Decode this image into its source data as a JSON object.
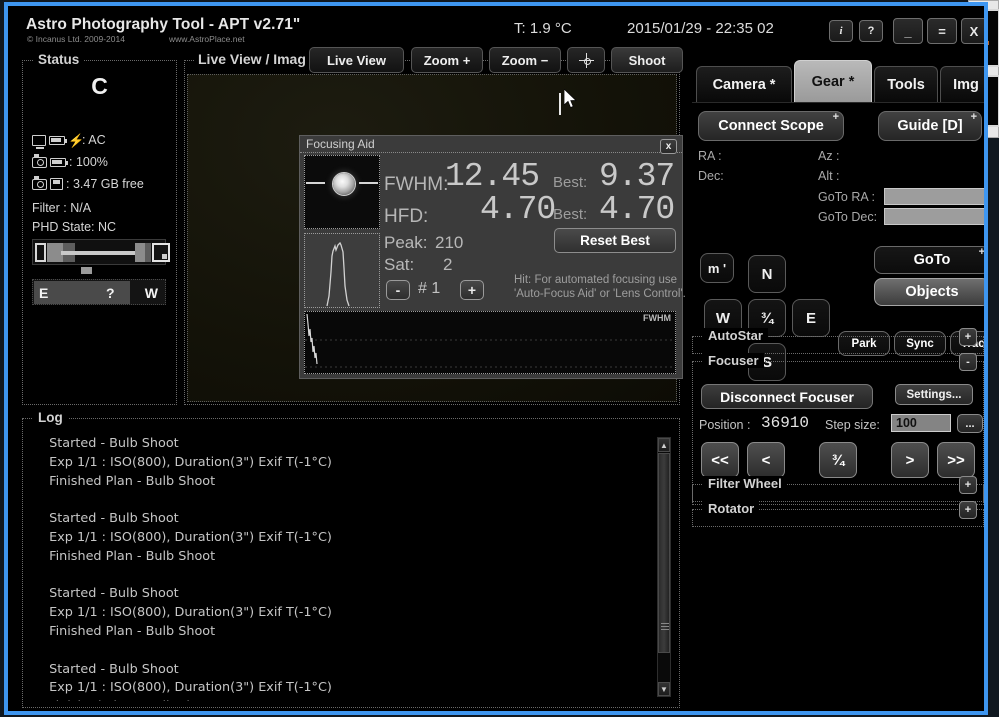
{
  "window": {
    "app_title": "Astro Photography Tool - APT v2.71\"",
    "copyright": "© Incanus Ltd. 2009-2014",
    "url": "www.AstroPlace.net",
    "temperature": "T: 1.9 °C",
    "datetime": "2015/01/29 - 22:35 02",
    "buttons": {
      "info": "i",
      "help": "?",
      "minimize": "_",
      "restore": "=",
      "close": "X"
    }
  },
  "status": {
    "title": "Status",
    "letter": "C",
    "power": ": AC",
    "battery": ": 100%",
    "disk": ": 3.47 GB free",
    "filter": "Filter : N/A",
    "phd_state": "PHD State: NC",
    "compass": {
      "east": "E",
      "unknown": "?",
      "west": "W"
    }
  },
  "liveview": {
    "title": "Live View / Imag",
    "buttons": {
      "live_view": "Live View",
      "zoom_in": "Zoom +",
      "zoom_out": "Zoom −",
      "shoot": "Shoot"
    }
  },
  "focusing_aid": {
    "title": "Focusing Aid",
    "close": "x",
    "fwhm_label": "FWHM:",
    "fwhm_value": "12.45",
    "fwhm_best_label": "Best:",
    "fwhm_best_value": "9.37",
    "hfd_label": "HFD:",
    "hfd_value": "4.70",
    "hfd_best_label": "Best:",
    "hfd_best_value": "4.70",
    "peak_label": "Peak:",
    "peak_value": "210",
    "sat_label": "Sat:",
    "sat_value": "2",
    "reset_best": "Reset Best",
    "minus": "-",
    "plus": "+",
    "counter": "# 1",
    "hint_line1": "Hit: For automated focusing use",
    "hint_line2": "'Auto-Focus Aid' or 'Lens Control'.",
    "chart_label": "FWHM"
  },
  "log": {
    "title": "Log",
    "text": "  Started - Bulb Shoot\n  Exp 1/1 : ISO(800), Duration(3\") Exif T(-1°C)\n  Finished Plan - Bulb Shoot\n\n  Started - Bulb Shoot\n  Exp 1/1 : ISO(800), Duration(3\") Exif T(-1°C)\n  Finished Plan - Bulb Shoot\n\n  Started - Bulb Shoot\n  Exp 1/1 : ISO(800), Duration(3\") Exif T(-1°C)\n  Finished Plan - Bulb Shoot\n\n  Started - Bulb Shoot\n  Exp 1/1 : ISO(800), Duration(3\") Exif T(-1°C)\n  Finished Plan - Bulb Shoot"
  },
  "right_panel": {
    "tabs": [
      {
        "label": "Camera *",
        "active": false
      },
      {
        "label": "Gear *",
        "active": true
      },
      {
        "label": "Tools",
        "active": false
      },
      {
        "label": "Img",
        "active": false
      }
    ],
    "connect_scope": "Connect Scope",
    "guide": "Guide [D]",
    "plus_badge": "+",
    "labels": {
      "ra": "RA :",
      "dec": "Dec:",
      "az": "Az :",
      "alt": "Alt :",
      "goto_ra": "GoTo RA :",
      "goto_dec": "GoTo Dec:"
    },
    "values": {
      "ra": "",
      "dec": "",
      "az": "",
      "alt": "",
      "goto_ra": "",
      "goto_dec": ""
    },
    "direction": {
      "rate": "m '",
      "north": "N",
      "west": "W",
      "stop": "¾",
      "east": "E",
      "south": "S"
    },
    "goto": "GoTo",
    "objects": "Objects",
    "park": "Park",
    "sync": "Sync",
    "track": "Track",
    "sections": {
      "autostar": {
        "title": "AutoStar",
        "toggle": "+"
      },
      "focuser": {
        "title": "Focuser",
        "toggle": "-"
      },
      "filter_wheel": {
        "title": "Filter Wheel",
        "toggle": "+"
      },
      "rotator": {
        "title": "Rotator",
        "toggle": "+"
      }
    },
    "focuser": {
      "disconnect": "Disconnect Focuser",
      "settings": "Settings...",
      "position_label": "Position :",
      "position_value": "36910",
      "stepsize_label": "Step size:",
      "stepsize_value": "100",
      "more": "...",
      "buttons": {
        "fast_back": "<<",
        "back": "<",
        "half": "¾",
        "fwd": ">",
        "fast_fwd": ">>"
      }
    }
  },
  "colors": {
    "window_border": "#3e96f0",
    "background": "#000000",
    "text": "#d6d6d6",
    "dialog_bg": "#3b3b3b",
    "active_tab": "#b9b9b9"
  }
}
